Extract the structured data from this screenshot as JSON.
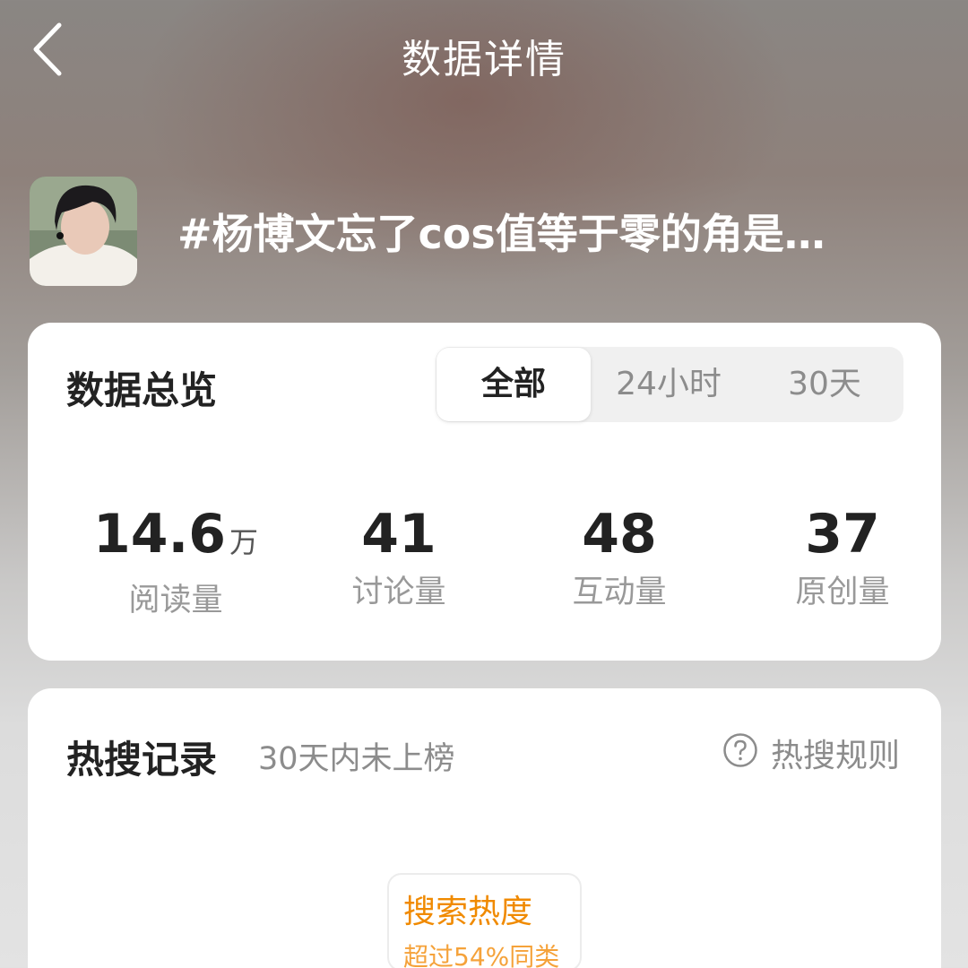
{
  "nav": {
    "title": "数据详情",
    "back_icon": "chevron-left-icon"
  },
  "topic": {
    "title": "#杨博文忘了cos值等于零的角是…"
  },
  "overview": {
    "title": "数据总览",
    "tabs": [
      {
        "label": "全部",
        "active": true
      },
      {
        "label": "24小时",
        "active": false
      },
      {
        "label": "30天",
        "active": false
      }
    ],
    "stats": [
      {
        "value": "14.6",
        "unit": "万",
        "label": "阅读量"
      },
      {
        "value": "41",
        "unit": "",
        "label": "讨论量"
      },
      {
        "value": "48",
        "unit": "",
        "label": "互动量"
      },
      {
        "value": "37",
        "unit": "",
        "label": "原创量"
      }
    ]
  },
  "hot_search": {
    "title": "热搜记录",
    "subtitle": "30天内未上榜",
    "rules_label": "热搜规则",
    "rules_icon": "help-circle-icon",
    "heat_title": "搜索热度",
    "heat_sub": "超过54%同类"
  },
  "colors": {
    "accent": "#f08a00",
    "text_primary": "#222222",
    "text_secondary": "#8c8c8c"
  }
}
